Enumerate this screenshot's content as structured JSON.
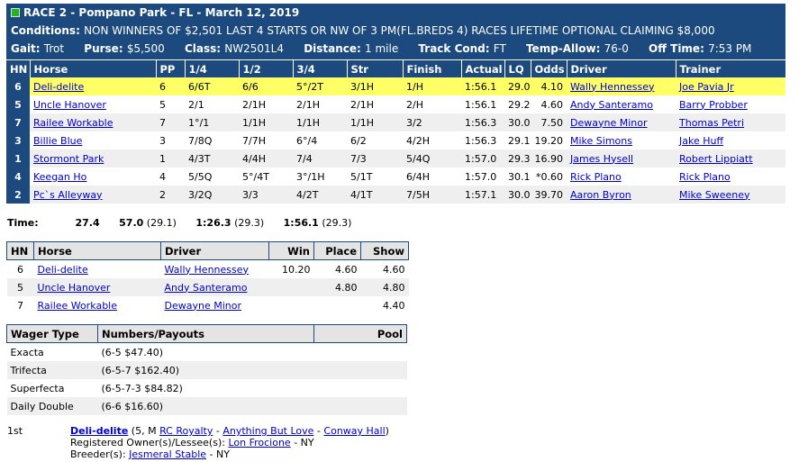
{
  "race": {
    "title": "RACE 2 - Pompano Park - FL - March 12, 2019",
    "conditions_label": "Conditions:",
    "conditions": "NON WINNERS OF $2,501 LAST 4 STARTS OR NW OF 3 PM(FL.BREDS 4) RACES LIFETIME OPTIONAL CLAIMING $8,000",
    "gait_label": "Gait:",
    "gait": "Trot",
    "purse_label": "Purse:",
    "purse": "$5,500",
    "class_label": "Class:",
    "class": "NW2501L4",
    "distance_label": "Distance:",
    "distance": "1 mile",
    "track_label": "Track Cond:",
    "track": "FT",
    "temp_label": "Temp-Allow:",
    "temp": "76-0",
    "off_label": "Off Time:",
    "off": "7:53 PM",
    "header_color": "#1c4a7e"
  },
  "results": {
    "headers": [
      "HN",
      "Horse",
      "PP",
      "1/4",
      "1/2",
      "3/4",
      "Str",
      "Finish",
      "Actual",
      "LQ",
      "Odds",
      "Driver",
      "Trainer"
    ],
    "rows": [
      {
        "hn": "6",
        "horse": "Deli-delite",
        "pp": "6",
        "q1": "6/6T",
        "q2": "6/6",
        "q3": "5°/2T",
        "str": "3/1H",
        "finish": "1/H",
        "actual": "1:56.1",
        "lq": "29.0",
        "odds": "4.10",
        "driver": "Wally Hennessey",
        "trainer": "Joe Pavia Jr"
      },
      {
        "hn": "5",
        "horse": "Uncle Hanover",
        "pp": "5",
        "q1": "2/1",
        "q2": "2/1H",
        "q3": "2/1H",
        "str": "2/1H",
        "finish": "2/H",
        "actual": "1:56.1",
        "lq": "29.2",
        "odds": "4.60",
        "driver": "Andy Santeramo",
        "trainer": "Barry Probber"
      },
      {
        "hn": "7",
        "horse": "Railee Workable",
        "pp": "7",
        "q1": "1°/1",
        "q2": "1/1H",
        "q3": "1/1H",
        "str": "1/1H",
        "finish": "3/2",
        "actual": "1:56.3",
        "lq": "30.0",
        "odds": "7.50",
        "driver": "Dewayne Minor",
        "trainer": "Thomas Petri"
      },
      {
        "hn": "3",
        "horse": "Billie Blue",
        "pp": "3",
        "q1": "7/8Q",
        "q2": "7/7H",
        "q3": "6°/4",
        "str": "6/2",
        "finish": "4/2H",
        "actual": "1:56.3",
        "lq": "29.1",
        "odds": "19.20",
        "driver": "Mike Simons",
        "trainer": "Jake Huff"
      },
      {
        "hn": "1",
        "horse": "Stormont Park",
        "pp": "1",
        "q1": "4/3T",
        "q2": "4/4H",
        "q3": "7/4",
        "str": "7/3",
        "finish": "5/4Q",
        "actual": "1:57.0",
        "lq": "29.3",
        "odds": "16.90",
        "driver": "James Hysell",
        "trainer": "Robert Lippiatt"
      },
      {
        "hn": "4",
        "horse": "Keegan Ho",
        "pp": "4",
        "q1": "5/5Q",
        "q2": "5°/4T",
        "q3": "3°/1H",
        "str": "5/1T",
        "finish": "6/4H",
        "actual": "1:57.0",
        "lq": "30.1",
        "odds": "*0.60",
        "driver": "Rick Plano",
        "trainer": "Rick Plano"
      },
      {
        "hn": "2",
        "horse": "Pc`s Alleyway",
        "pp": "2",
        "q1": "3/2Q",
        "q2": "3/3",
        "q3": "4/2T",
        "str": "4/1T",
        "finish": "7/5H",
        "actual": "1:57.1",
        "lq": "30.0",
        "odds": "39.70",
        "driver": "Aaron Byron",
        "trainer": "Mike Sweeney"
      }
    ]
  },
  "times": {
    "label": "Time:",
    "q1": "27.4",
    "q2": "57.0",
    "q2_split": "(29.1)",
    "q3": "1:26.3",
    "q3_split": "(29.3)",
    "final": "1:56.1",
    "final_split": "(29.3)"
  },
  "payouts": {
    "headers": [
      "HN",
      "Horse",
      "Driver",
      "Win",
      "Place",
      "Show"
    ],
    "rows": [
      {
        "hn": "6",
        "horse": "Deli-delite",
        "driver": "Wally Hennessey",
        "win": "10.20",
        "place": "4.60",
        "show": "4.60"
      },
      {
        "hn": "5",
        "horse": "Uncle Hanover",
        "driver": "Andy Santeramo",
        "win": "",
        "place": "4.80",
        "show": "4.80"
      },
      {
        "hn": "7",
        "horse": "Railee Workable",
        "driver": "Dewayne Minor",
        "win": "",
        "place": "",
        "show": "4.40"
      }
    ]
  },
  "wagers": {
    "headers": [
      "Wager Type",
      "Numbers/Payouts",
      "Pool"
    ],
    "rows": [
      {
        "type": "Exacta",
        "payout": "(6-5 $47.40)",
        "pool": ""
      },
      {
        "type": "Trifecta",
        "payout": "(6-5-7 $162.40)",
        "pool": ""
      },
      {
        "type": "Superfecta",
        "payout": "(6-5-7-3 $84.82)",
        "pool": ""
      },
      {
        "type": "Daily Double",
        "payout": "(6-6 $16.60)",
        "pool": ""
      }
    ]
  },
  "winner": {
    "position": "1st",
    "horse": "Deli-delite",
    "age_sex": "(5, M",
    "sire": "RC Royalty",
    "sep1": "-",
    "dam": "Anything But Love",
    "sep2": "-",
    "damsire": "Conway Hall",
    "close": ")",
    "owner_label": "Registered Owner(s)/Lessee(s):",
    "owner": "Lon Frocione",
    "owner_loc": "- NY",
    "breeder_label": "Breeder(s):",
    "breeder": "Jesmeral Stable",
    "breeder_loc": "- NY"
  }
}
